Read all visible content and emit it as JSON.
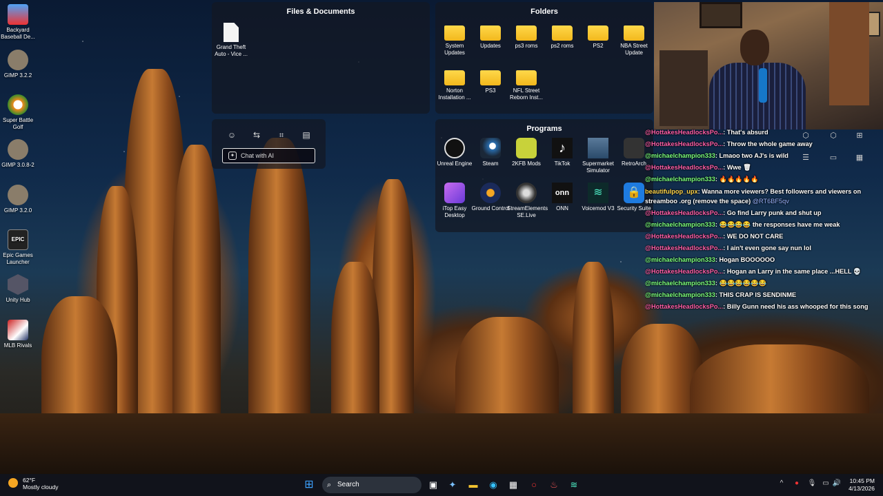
{
  "desktop": {
    "icons": [
      {
        "label": "Backyard Baseball De...",
        "icon": "backyard-baseball-icon",
        "color": "#e33"
      },
      {
        "label": "GIMP 3.2.2",
        "icon": "gimp-icon",
        "color": "#8a7d6a"
      },
      {
        "label": "Super Battle Golf",
        "icon": "golf-icon",
        "color": "#f28a1d"
      },
      {
        "label": "GIMP 3.0.8-2",
        "icon": "gimp-icon",
        "color": "#8a7d6a"
      },
      {
        "label": "GIMP 3.2.0",
        "icon": "gimp-icon",
        "color": "#8a7d6a"
      },
      {
        "label": "Epic Games Launcher",
        "icon": "epic-games-icon",
        "color": "#222"
      },
      {
        "label": "Unity Hub",
        "icon": "unity-icon",
        "color": "#555"
      },
      {
        "label": "MLB Rivals",
        "icon": "mlb-rivals-icon",
        "color": "#c22"
      }
    ]
  },
  "files_panel": {
    "title": "Files & Documents",
    "items": [
      {
        "label": "Grand Theft Auto - Vice ..."
      }
    ]
  },
  "folders_panel": {
    "title": "Folders",
    "items": [
      {
        "label": "System Updates"
      },
      {
        "label": "Updates"
      },
      {
        "label": "ps3 roms"
      },
      {
        "label": "ps2 roms"
      },
      {
        "label": "PS2"
      },
      {
        "label": "NBA Street Update"
      },
      {
        "label": "Norton Installation ..."
      },
      {
        "label": "PS3"
      },
      {
        "label": "NFL Street Reborn Inst..."
      }
    ]
  },
  "programs_panel": {
    "title": "Programs",
    "items": [
      {
        "label": "Unreal Engine",
        "color": "#111"
      },
      {
        "label": "Steam",
        "color": "#1b2838"
      },
      {
        "label": "2KFB Mods",
        "color": "#c8d23a"
      },
      {
        "label": "TikTok",
        "color": "#111"
      },
      {
        "label": "Supermarket Simulator",
        "color": "#2a4a6a"
      },
      {
        "label": "RetroArch",
        "color": "#333"
      },
      {
        "label": "iTop Easy Desktop",
        "color": "#8a4fd8"
      },
      {
        "label": "Ground Control",
        "color": "#1a2a5a"
      },
      {
        "label": "StreamElements SE.Live",
        "color": "#333"
      },
      {
        "label": "ONN",
        "color": "#111"
      },
      {
        "label": "Voicemod V3",
        "color": "#0d2a2a"
      },
      {
        "label": "Security Suite",
        "color": "#1e7be0"
      }
    ]
  },
  "toolbar": {
    "chat_ai": "Chat with AI"
  },
  "chat": {
    "messages": [
      {
        "user": "@HottakesHeadlocksPo...",
        "text": ": That's absurd",
        "cls": "u1"
      },
      {
        "user": "@HottakesHeadlocksPo...",
        "text": ": Throw the whole game away",
        "cls": "u1"
      },
      {
        "user": "@michaelchampion333",
        "text": ": Lmaoo two AJ's is wild",
        "cls": "u2"
      },
      {
        "user": "@HottakesHeadlocksPo...",
        "text": ": Wwe 🗑",
        "cls": "u1"
      },
      {
        "user": "@michaelchampion333",
        "text": ": 🔥🔥🔥🔥🔥",
        "cls": "u2"
      },
      {
        "user": "beautifulpop_upx",
        "text": ": Wanna more viewers? Best followers and viewers on streamboo .org (remove the space)",
        "mention": "@RT6BF5qv",
        "cls": "u3",
        "wrap": true
      },
      {
        "user": "@HottakesHeadlocksPo...",
        "text": ": Go find Larry punk and shut up",
        "cls": "u1"
      },
      {
        "user": "@michaelchampion333",
        "text": ": 😂😂😂😂 the responses have me weak",
        "cls": "u2"
      },
      {
        "user": "@HottakesHeadlocksPo...",
        "text": ": WE DO NOT CARE",
        "cls": "u1"
      },
      {
        "user": "@HottakesHeadlocksPo...",
        "text": ": I ain't even gone say nun lol",
        "cls": "u1"
      },
      {
        "user": "@michaelchampion333",
        "text": ": Hogan BOOOOOO",
        "cls": "u2"
      },
      {
        "user": "@HottakesHeadlocksPo...",
        "text": ": Hogan an Larry in the same place ...HELL 💀",
        "cls": "u1"
      },
      {
        "user": "@michaelchampion333",
        "text": ": 😂😂😂😂😂😂",
        "cls": "u2"
      },
      {
        "user": "@michaelchampion333",
        "text": ": THIS CRAP IS SENDINME",
        "cls": "u2"
      },
      {
        "user": "@HottakesHeadlocksPo...",
        "text": ": Billy Gunn need his ass whooped for this song",
        "cls": "u1"
      }
    ]
  },
  "taskbar": {
    "weather_temp": "62°F",
    "weather_desc": "Mostly cloudy",
    "search_label": "Search",
    "time": "10:45 PM",
    "date": "4/13/2026"
  }
}
